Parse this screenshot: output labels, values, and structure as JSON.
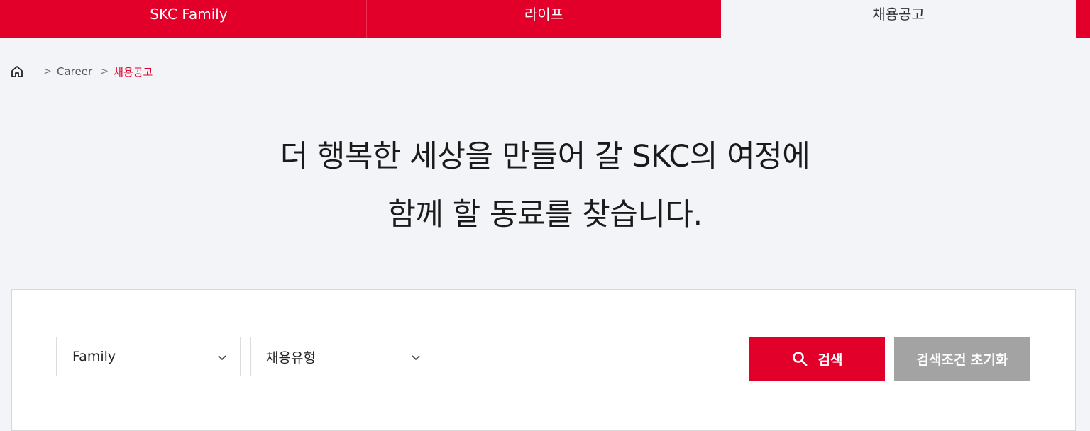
{
  "topnav": {
    "tabs": [
      {
        "label": "SKC Family"
      },
      {
        "label": "라이프"
      },
      {
        "label": "채용공고"
      }
    ]
  },
  "breadcrumb": {
    "home_icon": "home-icon",
    "items": [
      "Career",
      "채용공고"
    ],
    "separator": ">"
  },
  "headline": {
    "line1": "더 행복한 세상을 만들어 갈 SKC의 여정에",
    "line2": "함께 할 동료를 찾습니다."
  },
  "filters": {
    "family_select": "Family",
    "type_select": "채용유형",
    "search_label": "검색",
    "reset_label": "검색조건 초기화"
  },
  "colors": {
    "brand_red": "#e2002b",
    "reset_gray": "#a3a3a3",
    "page_bg": "#f3f4f8"
  }
}
